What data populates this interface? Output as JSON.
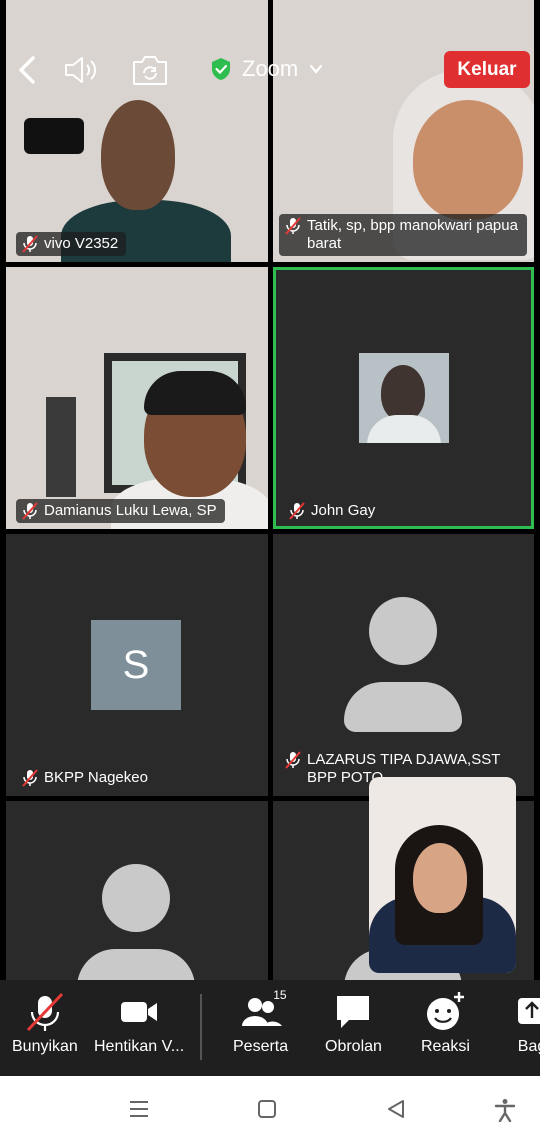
{
  "app": {
    "title": "Zoom",
    "leave_label": "Keluar"
  },
  "participants": [
    {
      "name": "vivo V2352"
    },
    {
      "name": "Tatik, sp, bpp manokwari papua barat"
    },
    {
      "name": "Damianus Luku Lewa, SP"
    },
    {
      "name": "John Gay"
    },
    {
      "name": "BKPP Nagekeo",
      "avatar_letter": "S"
    },
    {
      "name": "LAZARUS TIPA DJAWA,SST BPP POTO"
    }
  ],
  "toolbar": {
    "unmute_label": "Bunyikan",
    "stop_video_label": "Hentikan V...",
    "participants_label": "Peserta",
    "participants_count": "15",
    "chat_label": "Obrolan",
    "reactions_label": "Reaksi",
    "share_label": "Bag"
  },
  "colors": {
    "active_speaker": "#2ebd4f",
    "leave": "#e02f30",
    "toolbar_bg": "#1f1f1f"
  },
  "icons": [
    "back-icon",
    "speaker-icon",
    "switch-camera-icon",
    "shield-check-icon",
    "chevron-down-icon",
    "mic-muted-icon",
    "video-icon",
    "participants-icon",
    "chat-icon",
    "reaction-icon",
    "share-icon",
    "menu-icon",
    "home-icon",
    "back-nav-icon",
    "accessibility-icon"
  ]
}
